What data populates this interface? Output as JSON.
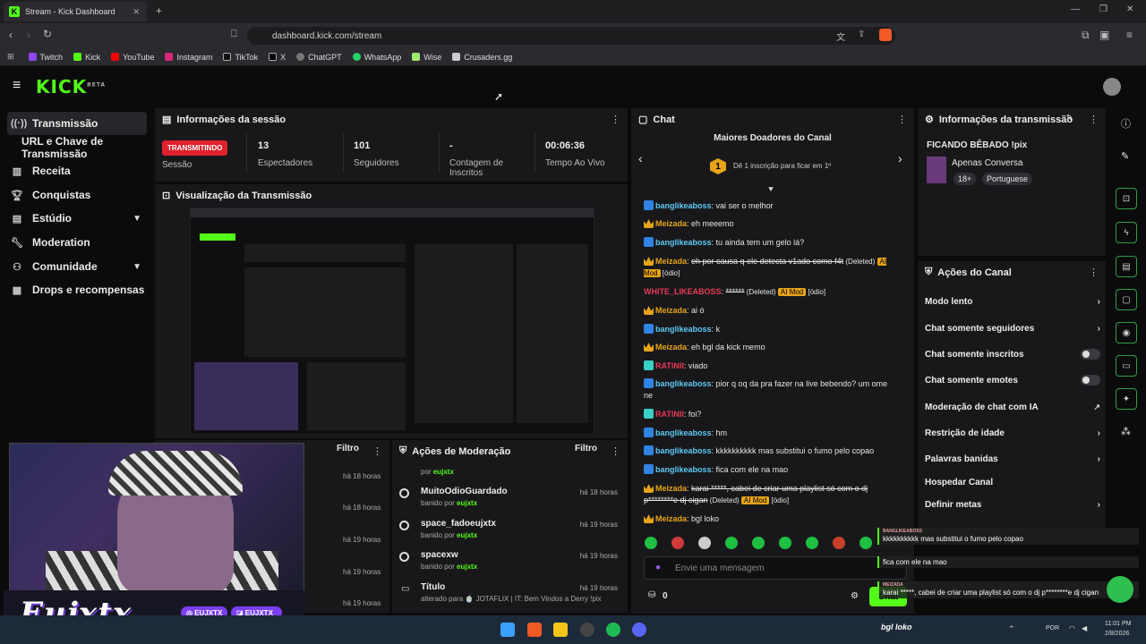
{
  "browser": {
    "tab_title": "Stream - Kick Dashboard",
    "url": "dashboard.kick.com/stream",
    "bookmarks": [
      "Twitch",
      "Kick",
      "YouTube",
      "Instagram",
      "TikTok",
      "X",
      "ChatGPT",
      "WhatsApp",
      "Wise",
      "Crusaders.gg"
    ]
  },
  "app": {
    "logo": "KICK",
    "logo_sup": "BETA"
  },
  "sidebar": {
    "items": [
      {
        "label": "Transmissão",
        "icon": "broadcast-icon"
      },
      {
        "label": "URL e Chave de Transmissão"
      },
      {
        "label": "Receita",
        "icon": "chart-icon"
      },
      {
        "label": "Conquistas",
        "icon": "trophy-icon"
      },
      {
        "label": "Estúdio",
        "icon": "studio-icon"
      },
      {
        "label": "Moderation",
        "icon": "wrench-icon"
      },
      {
        "label": "Comunidade",
        "icon": "community-icon"
      },
      {
        "label": "Drops e recompensas",
        "icon": "drops-icon"
      }
    ]
  },
  "session": {
    "title": "Informações da sessão",
    "status_badge": "TRANSMITINDO",
    "status_label": "Sessão",
    "viewers": "13",
    "viewers_label": "Espectadores",
    "followers": "101",
    "followers_label": "Seguidores",
    "subs": "-",
    "subs_label": "Contagem de Inscritos",
    "uptime": "00:06:36",
    "uptime_label": "Tempo Ao Vivo"
  },
  "preview": {
    "title": "Visualização da Transmissão"
  },
  "left_lower": {
    "filter": "Filtro",
    "times": [
      "há 18 horas",
      "há 18 horas",
      "há 19 horas",
      "há 19 horas",
      "há 19 horas",
      "há 19 horas"
    ]
  },
  "moderation": {
    "title": "Ações de Moderação",
    "filter": "Filtro",
    "first_by": "por",
    "first_user": "eujxtx",
    "items": [
      {
        "title": "MuitoOdioGuardado",
        "action": "banido por",
        "by": "eujxtx",
        "time": "há 18 horas"
      },
      {
        "title": "space_fadoeujxtx",
        "action": "banido por",
        "by": "eujxtx",
        "time": "há 19 horas"
      },
      {
        "title": "spacexw",
        "action": "banido por",
        "by": "eujxtx",
        "time": "há 19 horas"
      },
      {
        "title": "Título",
        "action": "alterado para",
        "by": "🍵 JOTAFLIX | IT: Bem Vindos a Derry !pix",
        "time": "há 19 horas"
      }
    ]
  },
  "chat": {
    "title": "Chat",
    "top_donors": "Maiores Doadores do Canal",
    "donor_rank": "1",
    "donor_text": "Dê 1 inscrição para ficar em 1º",
    "placeholder": "Envie uma mensagem",
    "coins": "0",
    "send": "Chat",
    "messages": [
      {
        "user": "banglikeaboss",
        "text": "vai ser o melhor"
      },
      {
        "user": "Meizada",
        "text": "eh meeemo"
      },
      {
        "user": "banglikeaboss",
        "text": "tu ainda tem um gelo lá?"
      },
      {
        "user": "Meizada",
        "text": "eh por causa q ele detecta v1ado como f4t",
        "deleted": "(Deleted)",
        "tag": "AI Mod",
        "extra": "[ódio]"
      },
      {
        "user": "WHITE_LIKEABOSS",
        "text": "******",
        "deleted": "(Deleted)",
        "tag": "AI Mod",
        "extra": "[ódio]"
      },
      {
        "user": "Meizada",
        "text": "ai ó"
      },
      {
        "user": "banglikeaboss",
        "text": "k"
      },
      {
        "user": "Meizada",
        "text": "eh bgl da kick memo"
      },
      {
        "user": "RATINII",
        "text": "viado"
      },
      {
        "user": "banglikeaboss",
        "text": "pior q oq da pra fazer na live bebendo? um ome ne"
      },
      {
        "user": "RATINII",
        "text": "foi?"
      },
      {
        "user": "banglikeaboss",
        "text": "hm"
      },
      {
        "user": "banglikeaboss",
        "text": "kkkkkkkkkk mas substitui o fumo pelo copao"
      },
      {
        "user": "banglikeaboss",
        "text": "fica com ele na mao"
      },
      {
        "user": "Meizada",
        "text": "karai *****, cabei de criar uma playlist só com o dj p********e dj cigan",
        "deleted": "(Deleted)",
        "tag": "AI Mod",
        "extra": "[ódio]"
      },
      {
        "user": "Meizada",
        "text": "bgl loko"
      }
    ]
  },
  "stream_info": {
    "title": "Informações da transmissão",
    "stream_title": "FICANDO BÊBADO !pix",
    "category": "Apenas Conversa",
    "age": "18+",
    "language": "Portuguese"
  },
  "channel_actions": {
    "title": "Ações do Canal",
    "items": [
      "Modo lento",
      "Chat somente seguidores",
      "Chat somente inscritos",
      "Chat somente emotes",
      "Moderação de chat com IA",
      "Restrição de idade",
      "Palavras banidas",
      "Hospedar Canal",
      "Definir metas"
    ]
  },
  "overlay": {
    "notifications": [
      {
        "user": "BANGLIKEABOSS",
        "text": "kkkkkkkkkk mas substitui o fumo pelo copao"
      },
      {
        "user": "",
        "text": "fica com ele na mao"
      },
      {
        "user": "MEIZADA",
        "text": "karai *****, cabei de criar uma playlist só com o dj p********e dj cigan"
      },
      {
        "user": "MEIZADA",
        "text": "bgl loko"
      }
    ],
    "brand": "Eujxtx",
    "handle1": "EUJXTX",
    "handle2": "EUJXTX_"
  },
  "taskbar": {
    "lang": "POR",
    "time": "11:01 PM",
    "date": "2/8/2026"
  },
  "colors": {
    "accent": "#53fc18",
    "panel": "#18181b",
    "live": "#e0212e",
    "mod_tag": "#e8a417"
  }
}
